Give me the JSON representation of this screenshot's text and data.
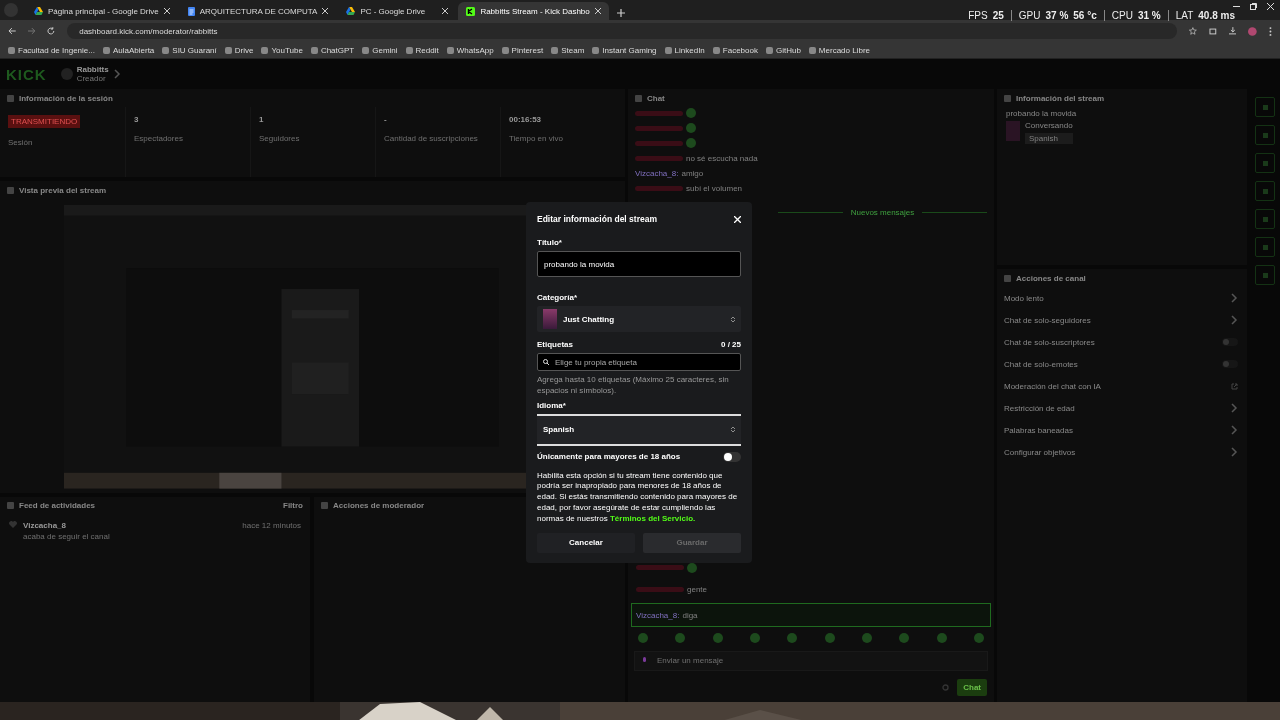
{
  "browser": {
    "tabs": [
      {
        "kind": "drive",
        "title": "Página principal - Google Drive",
        "selected": false
      },
      {
        "kind": "doc",
        "title": "ARQUITECTURA DE COMPUTA",
        "selected": false
      },
      {
        "kind": "drive",
        "title": "PC - Google Drive",
        "selected": false
      },
      {
        "kind": "kick",
        "title": "Rabbitts Stream - Kick Dashbo",
        "selected": true
      }
    ],
    "url": "dashboard.kick.com/moderator/rabbitts",
    "bookmarks": [
      "Facultad de Ingenie...",
      "AulaAbierta",
      "SIU Guaraní",
      "Drive",
      "YouTube",
      "ChatGPT",
      "Gemini",
      "Reddit",
      "WhatsApp",
      "Pinterest",
      "Steam",
      "Instant Gaming",
      "LinkedIn",
      "Facebook",
      "GitHub",
      "Mercado Libre"
    ],
    "stats": [
      {
        "label": "FPS",
        "values": [
          "25"
        ]
      },
      {
        "label": "GPU",
        "values": [
          "37 %",
          "56 °c"
        ]
      },
      {
        "label": "CPU",
        "values": [
          "31 %"
        ]
      },
      {
        "label": "LAT",
        "values": [
          "40.8 ms"
        ]
      }
    ]
  },
  "dashboard": {
    "logo": "KICK",
    "user": {
      "name": "Rabbitts",
      "role": "Creador"
    },
    "session": {
      "title": "Información de la sesión",
      "badge": "TRANSMITIENDO",
      "badge_label": "Sesión",
      "stats": [
        {
          "value": "3",
          "label": "Espectadores"
        },
        {
          "value": "1",
          "label": "Seguidores"
        },
        {
          "value": "-",
          "label": "Cantidad de suscripciones"
        },
        {
          "value": "00:16:53",
          "label": "Tiempo en vivo"
        }
      ]
    },
    "preview": {
      "title": "Vista previa del stream"
    },
    "feed": {
      "title": "Feed de actividades",
      "filter": "Filtro",
      "items": [
        {
          "user": "Vizcacha_8",
          "text": "acaba de seguir el canal",
          "time": "hace 12 minutos"
        }
      ]
    },
    "mod_actions": {
      "title": "Acciones de moderador"
    },
    "chat": {
      "title": "Chat",
      "messages": [
        {
          "emote": true
        },
        {
          "emote": true
        },
        {
          "emote": true
        },
        {
          "text": "no sé escucha nada"
        },
        {
          "user": "Vizcacha_8:",
          "text": "amigo"
        },
        {
          "text": "subí el volumen"
        }
      ],
      "divider": "Nuevos mensajes",
      "recent": [
        {
          "emote": true,
          "highlighted": false
        },
        {
          "text": "gente",
          "highlighted": false
        },
        {
          "user": "Vizcacha_8:",
          "text": "diga",
          "highlighted": true
        }
      ],
      "input_placeholder": "Enviar un mensaje",
      "send": "Chat"
    },
    "stream_info": {
      "title": "Información del stream",
      "stream_title": "probando la movida",
      "category": "Conversando",
      "language": "Spanish"
    },
    "channel_actions": {
      "title": "Acciones de canal",
      "items": [
        {
          "kind": "chevron",
          "label": "Modo lento"
        },
        {
          "kind": "chevron",
          "label": "Chat de solo-seguidores"
        },
        {
          "kind": "toggle",
          "label": "Chat de solo-suscriptores",
          "on": false
        },
        {
          "kind": "toggle",
          "label": "Chat de solo-emotes",
          "on": false
        },
        {
          "kind": "external",
          "label": "Moderación del chat con IA"
        },
        {
          "kind": "chevron",
          "label": "Restricción de edad"
        },
        {
          "kind": "chevron",
          "label": "Palabras baneadas"
        },
        {
          "kind": "chevron",
          "label": "Configurar objetivos"
        }
      ]
    }
  },
  "modal": {
    "title": "Editar información del stream",
    "title_field": {
      "label": "Título*",
      "value": "probando la movida"
    },
    "category": {
      "label": "Categoría*",
      "value": "Just Chatting"
    },
    "tags": {
      "label": "Etiquetas",
      "count": "0 / 25",
      "placeholder": "Elige tu propia etiqueta",
      "hint": "Agrega hasta 10 etiquetas (Máximo 25 caracteres, sin espacios ni símbolos)."
    },
    "language": {
      "label": "Idioma*",
      "value": "Spanish"
    },
    "adult": {
      "label": "Únicamente para mayores de 18 años",
      "on": false,
      "description": "Habilita esta opción si tu stream tiene contenido que podría ser inapropiado para menores de 18 años de edad. Si estás transmitiendo contenido para mayores de edad, por favor asegúrate de estar cumpliendo las normas de nuestros",
      "link": "Términos del Servicio."
    },
    "cancel": "Cancelar",
    "save": {
      "label": "Guardar",
      "disabled": true
    }
  }
}
